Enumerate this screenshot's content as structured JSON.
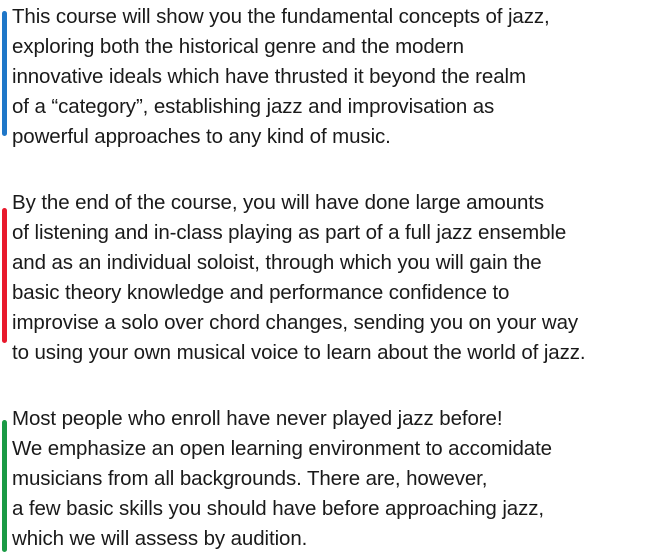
{
  "colors": {
    "bar_blue": "#1f77c8",
    "bar_red": "#e8192c",
    "bar_green": "#1a9a45",
    "text": "#1a1a1a",
    "background": "#ffffff"
  },
  "paragraphs": [
    {
      "lines": [
        "This course will show you the fundamental concepts of jazz,",
        "exploring both the historical genre and the modern",
        "innovative ideals which have thrusted it beyond the realm",
        "of a “category”, establishing jazz and improvisation as",
        "powerful approaches to any kind of music."
      ]
    },
    {
      "lines": [
        "By the end of the course, you will have done large amounts",
        "of listening and in-class playing as part of a full jazz ensemble",
        "and as an individual soloist, through which you will gain the",
        "basic theory knowledge and performance confidence to",
        "improvise a solo over chord changes, sending you on your way",
        "to using your own musical voice to learn about the world of jazz."
      ]
    },
    {
      "lines": [
        "Most people who enroll have never played jazz before!",
        "We emphasize an open learning environment to accomidate",
        "musicians from all backgrounds. There are, however,",
        "a few basic skills you should have before approaching jazz,",
        "which we will assess by audition."
      ]
    }
  ]
}
